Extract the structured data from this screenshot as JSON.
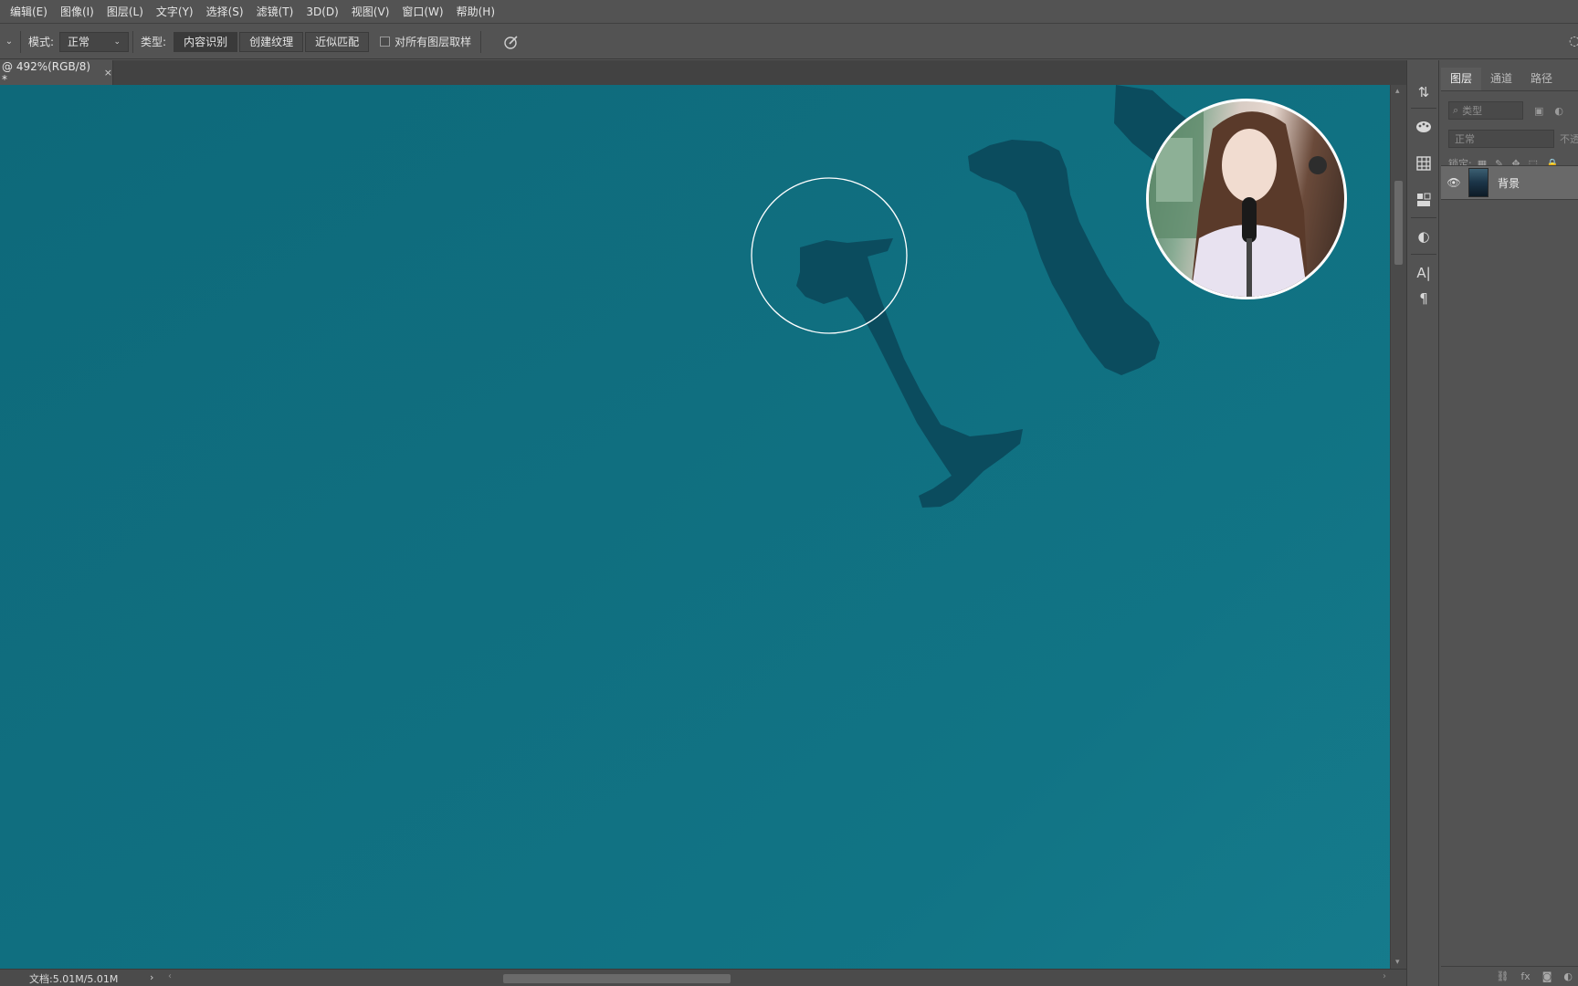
{
  "menubar": {
    "items": [
      "编辑(E)",
      "图像(I)",
      "图层(L)",
      "文字(Y)",
      "选择(S)",
      "滤镜(T)",
      "3D(D)",
      "视图(V)",
      "窗口(W)",
      "帮助(H)"
    ]
  },
  "options": {
    "mode_label": "模式:",
    "mode_value": "正常",
    "type_label": "类型:",
    "type_buttons": [
      "内容识别",
      "创建纹理",
      "近似匹配"
    ],
    "sample_all_layers_label": "对所有图层取样"
  },
  "document": {
    "tab_title": "@ 492%(RGB/8) *",
    "close_glyph": "×"
  },
  "canvas": {
    "background_color": "#0f6e7f",
    "letter_color": "#0a4a5c",
    "brush_cursor_color": "#ffffff"
  },
  "status": {
    "doc_size": "文档:5.01M/5.01M",
    "arrow_glyph": "›"
  },
  "toolstrip": {
    "tools": [
      "history-icon",
      "color-palette-icon",
      "swatches-grid-icon",
      "libraries-icon",
      "adjustments-icon",
      "character-icon",
      "paragraph-icon"
    ],
    "glyphs": [
      "⇅",
      "🎨",
      "▦",
      "⊞",
      "◐",
      "A|",
      "¶"
    ]
  },
  "layers_panel": {
    "tabs": [
      "图层",
      "通道",
      "路径"
    ],
    "active_tab": "图层",
    "filter_placeholder": "类型",
    "blend_mode": "正常",
    "opacity_label": "不透",
    "lock_label": "锁定:",
    "layers": [
      {
        "name": "背景",
        "visible": true
      }
    ]
  }
}
